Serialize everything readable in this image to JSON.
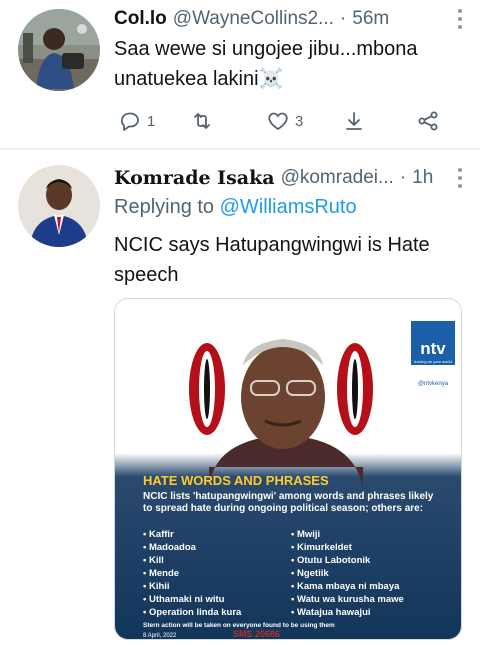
{
  "tweet1": {
    "display_name": "Col.lo",
    "handle": "@WayneCollins2...",
    "separator": "·",
    "time": "56m",
    "text": "Saa wewe si ungojee jibu...mbona unatuekea lakini☠️",
    "actions": {
      "reply_count": "1",
      "retweet_count": "",
      "like_count": "3"
    }
  },
  "tweet2": {
    "display_name": "Komrade Isaka",
    "handle": "@komradei...",
    "separator": "·",
    "time": "1h",
    "replying_prefix": "Replying to ",
    "replying_to": "@WilliamsRuto",
    "text": "NCIC says Hatupangwingwi is Hate speech",
    "media": {
      "channel_logo": "ntv",
      "channel_tagline": "turning on your world",
      "social_handle": "@ntvkenya",
      "heading": "HATE WORDS AND PHRASES",
      "subheading": "NCIC lists 'hatupangwingwi' among words and phrases likely to spread hate during ongoing political season; others are:",
      "left_list": [
        "Kaffir",
        "Madoadoa",
        "Kill",
        "Mende",
        "Kihii",
        "Uthamaki ni witu",
        "Operation linda kura"
      ],
      "right_list": [
        "Mwiji",
        "Kimurkeldet",
        "Otutu Labotonik",
        "Ngetiik",
        "Kama mbaya ni mbaya",
        "Watu wa kurusha mawe",
        "Watajua hawajui"
      ],
      "footer": "Stern action will be taken on everyone found to be using them",
      "date": "8 April, 2022",
      "sms_code": "SMS 20686"
    }
  },
  "colors": {
    "accent": "#1d9bf0",
    "secondary_text": "#536471",
    "media_bg": "#173e64",
    "heading_yellow": "#ffcc2f"
  }
}
